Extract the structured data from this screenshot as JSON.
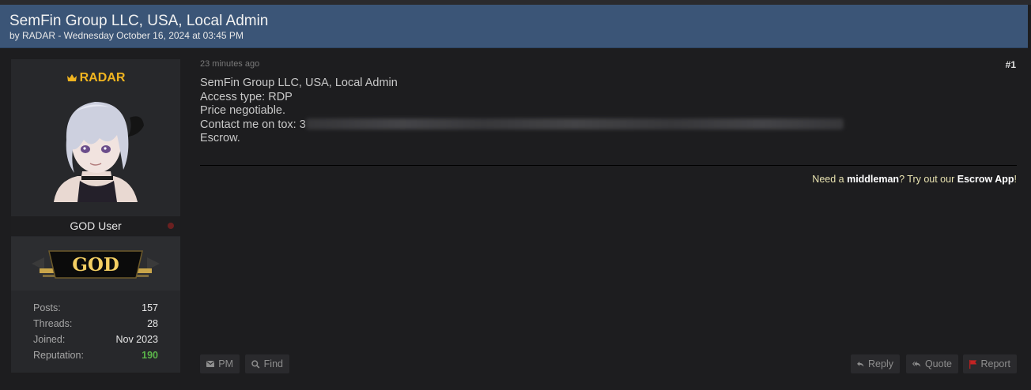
{
  "thread": {
    "title": "SemFin Group LLC, USA, Local Admin",
    "meta": "by RADAR - Wednesday October 16, 2024 at 03:45 PM"
  },
  "user": {
    "name": "RADAR",
    "name_color": "#f0b420",
    "title": "GOD User",
    "rank_text": "GOD",
    "stats": [
      {
        "label": "Posts:",
        "value": "157"
      },
      {
        "label": "Threads:",
        "value": "28"
      },
      {
        "label": "Joined:",
        "value": "Nov 2023"
      },
      {
        "label": "Reputation:",
        "value": "190"
      }
    ],
    "reputation_color": "#5bb54a"
  },
  "post": {
    "time": "23 minutes ago",
    "number": "#1",
    "lines": [
      "SemFin Group LLC, USA, Local Admin",
      "Access type: RDP",
      "Price negotiable.",
      "Contact me on tox: 3",
      "Escrow."
    ]
  },
  "signature": {
    "part1": "Need a ",
    "bold1": "middleman",
    "part2": "? Try out our ",
    "bold2": "Escrow App",
    "part3": "!"
  },
  "buttons": {
    "pm": "PM",
    "find": "Find",
    "reply": "Reply",
    "quote": "Quote",
    "report": "Report"
  },
  "icons": {
    "crown": "crown-icon",
    "pm": "envelope-icon",
    "find": "search-icon",
    "reply": "reply-arrow-icon",
    "quote": "reply-all-icon",
    "report": "flag-icon"
  }
}
